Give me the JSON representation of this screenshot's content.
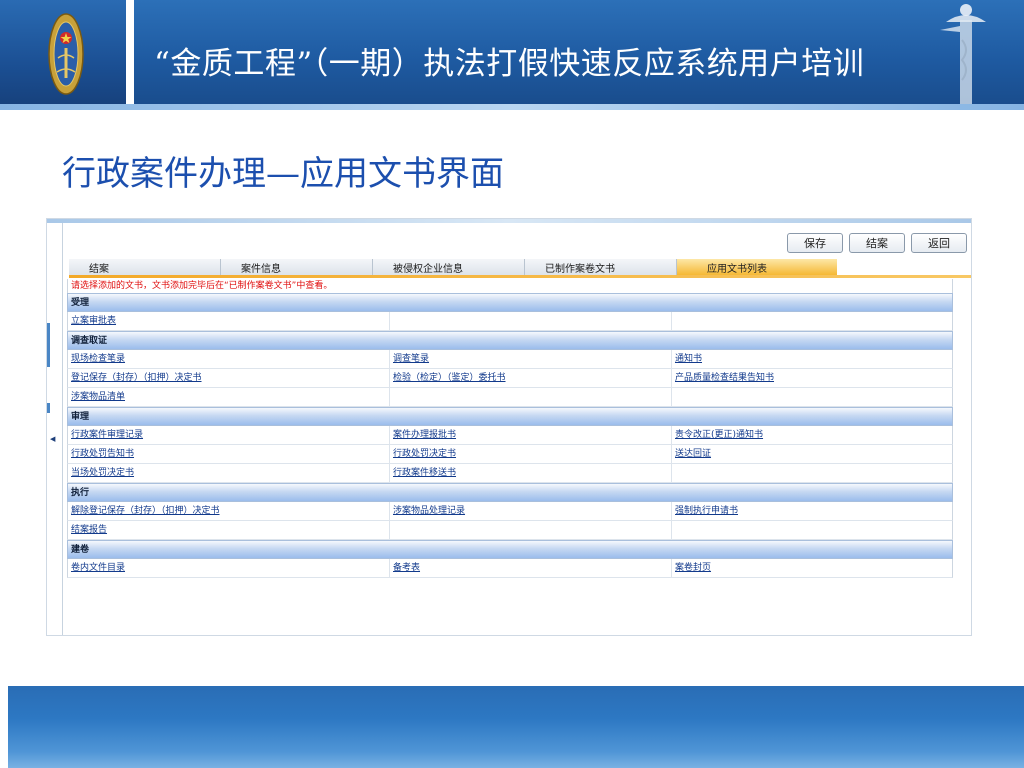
{
  "header": {
    "title": "“金质工程”（一期）执法打假快速反应系统用户培训",
    "colors": {
      "band": "#1e5aa1",
      "accent": "#86b4e3"
    }
  },
  "subtitle": "行政案件办理—应用文书界面",
  "app": {
    "toolbar": {
      "save": "保存",
      "close_case": "结案",
      "back": "返回"
    },
    "tabs": [
      {
        "label": "结案"
      },
      {
        "label": "案件信息"
      },
      {
        "label": "被侵权企业信息"
      },
      {
        "label": "已制作案卷文书"
      },
      {
        "label": "应用文书列表",
        "active": true
      }
    ],
    "notice": "请选择添加的文书，文书添加完毕后在“已制作案卷文书”中查看。",
    "sections": [
      {
        "title": "受理",
        "rows": [
          [
            "立案审批表",
            "",
            ""
          ]
        ]
      },
      {
        "title": "调查取证",
        "rows": [
          [
            "现场检查笔录",
            "调查笔录",
            "通知书"
          ],
          [
            "登记保存（封存）（扣押）决定书",
            "检验（检定）（鉴定）委托书",
            "产品质量检查结果告知书"
          ],
          [
            "涉案物品清单",
            "",
            ""
          ]
        ]
      },
      {
        "title": "审理",
        "rows": [
          [
            "行政案件审理记录",
            "案件办理报批书",
            "责令改正(更正)通知书"
          ],
          [
            "行政处罚告知书",
            "行政处罚决定书",
            "送达回证"
          ],
          [
            "当场处罚决定书",
            "行政案件移送书",
            ""
          ]
        ]
      },
      {
        "title": "执行",
        "rows": [
          [
            "解除登记保存（封存）（扣押）决定书",
            "涉案物品处理记录",
            "强制执行申请书"
          ],
          [
            "结案报告",
            "",
            ""
          ]
        ]
      },
      {
        "title": "建卷",
        "rows": [
          [
            "卷内文件目录",
            "备考表",
            "案卷封页"
          ]
        ]
      }
    ],
    "colors": {
      "notice": "#e01010",
      "link": "#123a8c",
      "active_tab": "#f5b834"
    }
  }
}
